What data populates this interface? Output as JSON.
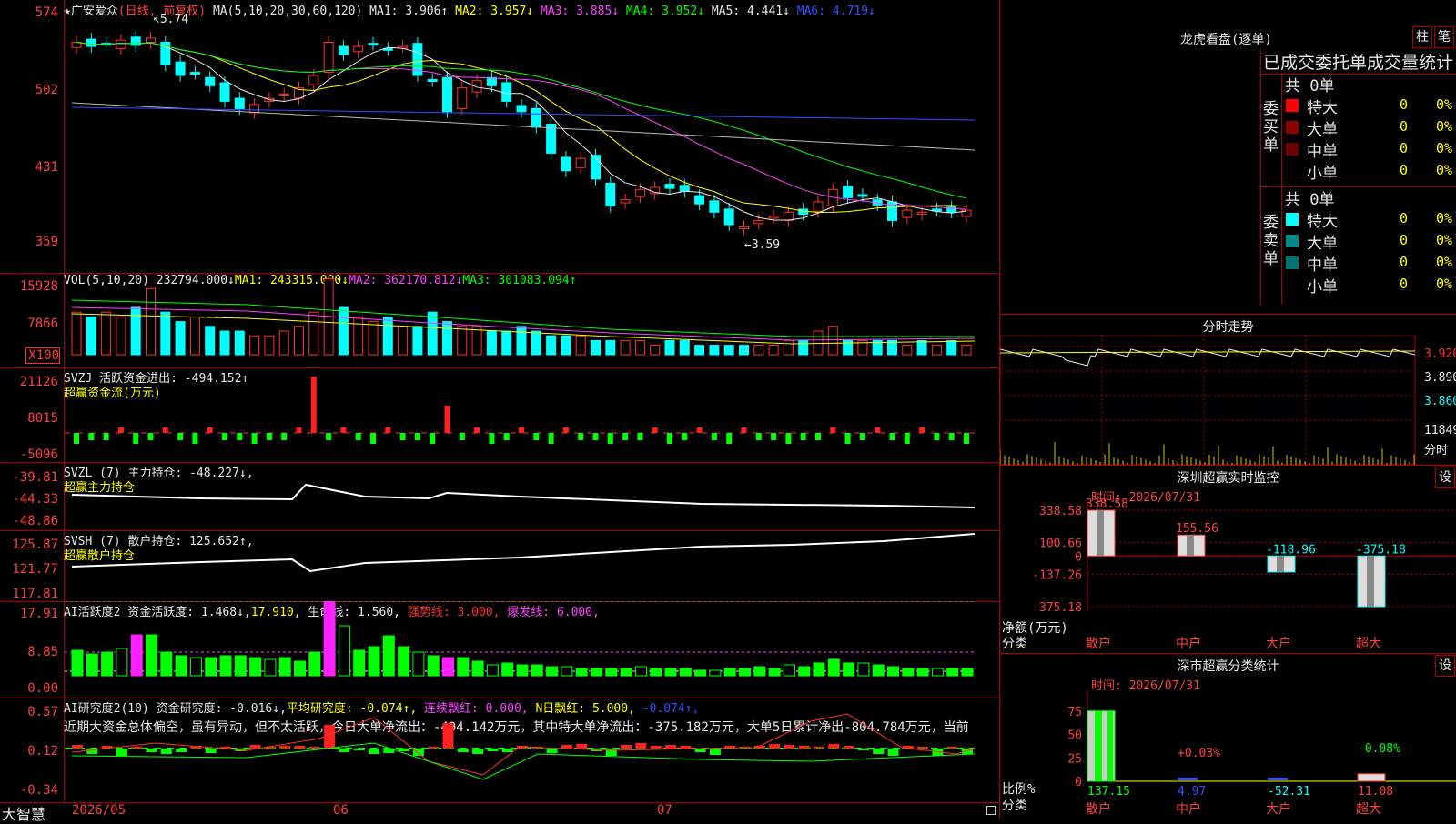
{
  "main": {
    "title": "★广安爱众",
    "mode": "(日线, 前复权)",
    "ma_label": "MA(5,10,20,30,60,120)",
    "ma": [
      {
        "name": "MA1:",
        "value": "3.906↑",
        "color": "#e8e8e8"
      },
      {
        "name": "MA2:",
        "value": "3.957↓",
        "color": "#ffff00"
      },
      {
        "name": "MA3:",
        "value": "3.885↓",
        "color": "#ff40ff"
      },
      {
        "name": "MA4:",
        "value": "3.952↓",
        "color": "#00ff00"
      },
      {
        "name": "MA5:",
        "value": "4.441↓",
        "color": "#e8e8e8"
      },
      {
        "name": "MA6:",
        "value": "4.719↓",
        "color": "#3050ff"
      }
    ],
    "y_labels": [
      "574",
      "502",
      "431",
      "359"
    ],
    "high_mark": "5.74",
    "low_mark": "←3.59"
  },
  "vol": {
    "label": "VOL(5,10,20)",
    "value": "232794.000↓",
    "ma1": "MA1: 243315.000↓",
    "ma2": "MA2: 362170.812↓",
    "ma3": "MA3: 301083.094↑",
    "y_labels": [
      "15928",
      "7866"
    ],
    "unit": "X100"
  },
  "svzj": {
    "label": "SVZJ  活跃资金进出:",
    "value": "-494.152↑",
    "sub": "超赢资金流(万元)",
    "y_labels": [
      "21126",
      "8015",
      "-5096"
    ]
  },
  "svzl": {
    "label": "SVZL (7) 主力持仓:",
    "value": "-48.227↓,",
    "sub": "超赢主力持仓",
    "y_labels": [
      "-39.81",
      "-44.33",
      "-48.86"
    ]
  },
  "svsh": {
    "label": "SVSH (7) 散户持仓:",
    "value": "125.652↑,",
    "sub": "超赢散户持仓",
    "y_labels": [
      "125.87",
      "121.77",
      "117.81"
    ]
  },
  "ai1": {
    "label": "AI活跃度2 资金活跃度:",
    "v1": "1.468↓,",
    "v2": "17.910,",
    "life": "生命线: 1.560,",
    "strong": "强势线: 3.000,",
    "burst": "爆发线: 6.000,",
    "y_labels": [
      "17.91",
      "8.85",
      "0.00"
    ]
  },
  "ai2": {
    "label": "AI研究度2(10) 资金研究度:",
    "v1": "-0.016↓,",
    "avg": "平均研究度: -0.074↑,",
    "red": "连续飘红: 0.000,",
    "nred": "N日飘红: 5.000,",
    "last": "-0.074↑,",
    "text": "近期大资金总体偏空，虽有异动，但不太活跃，今日大单净流出：-494.142万元，其中特大单净流出：-375.182万元，大单5日累计净出-804.784万元，当前",
    "y_labels": [
      "0.57",
      "0.12",
      "-0.34"
    ]
  },
  "footer": {
    "brand": "大智慧",
    "dates": [
      "2026/05",
      "06",
      "07"
    ]
  },
  "lhb": {
    "title": "龙虎看盘(逐单)",
    "btn1": "柱",
    "btn2": "笔",
    "tabs": "已成交委托单成交量统计",
    "buy": {
      "side": "委买单",
      "total": "共 0单",
      "rows": [
        {
          "label": "特大",
          "value": "0",
          "pct": "0%",
          "color": "#ff0000"
        },
        {
          "label": "大单",
          "value": "0",
          "pct": "0%",
          "color": "#8b0000"
        },
        {
          "label": "中单",
          "value": "0",
          "pct": "0%",
          "color": "#6a0000"
        },
        {
          "label": "小单",
          "value": "0",
          "pct": "0%",
          "color": ""
        }
      ]
    },
    "sell": {
      "side": "委卖单",
      "total": "共 0单",
      "rows": [
        {
          "label": "特大",
          "value": "0",
          "pct": "0%",
          "color": "#00ffff"
        },
        {
          "label": "大单",
          "value": "0",
          "pct": "0%",
          "color": "#008b8b"
        },
        {
          "label": "中单",
          "value": "0",
          "pct": "0%",
          "color": "#007070"
        },
        {
          "label": "小单",
          "value": "0",
          "pct": "0%",
          "color": ""
        }
      ]
    }
  },
  "fenshi": {
    "title": "分时走势",
    "y_labels": [
      "3.920",
      "3.890",
      "3.860"
    ],
    "vol_label": "11849",
    "unit": "分时"
  },
  "monitor": {
    "title": "深圳超赢实时监控",
    "setting": "设",
    "time": "时间: 2026/07/31",
    "y_labels": [
      "338.58",
      "100.66",
      "0",
      "-137.26",
      "-375.18"
    ],
    "ylabel1": "净额(万元)",
    "ylabel2": "分类",
    "categories": [
      "散户",
      "中户",
      "大户",
      "超大"
    ],
    "values": [
      338.58,
      155.56,
      -118.96,
      -375.18
    ],
    "value_labels": [
      "338.58",
      "155.56",
      "-118.96",
      "-375.18"
    ]
  },
  "classify": {
    "title": "深市超赢分类统计",
    "setting": "设",
    "time": "时间: 2026/07/31",
    "y_labels": [
      "75",
      "50",
      "25",
      "0"
    ],
    "ylabel1": "比例%",
    "ylabel2": "分类",
    "categories": [
      "散户",
      "中户",
      "大户",
      "超大"
    ],
    "top_labels": [
      "",
      "+0.03%",
      "",
      "-0.08%"
    ],
    "bottom_values": [
      "137.15",
      "4.97",
      "-52.31",
      "11.08"
    ]
  }
}
